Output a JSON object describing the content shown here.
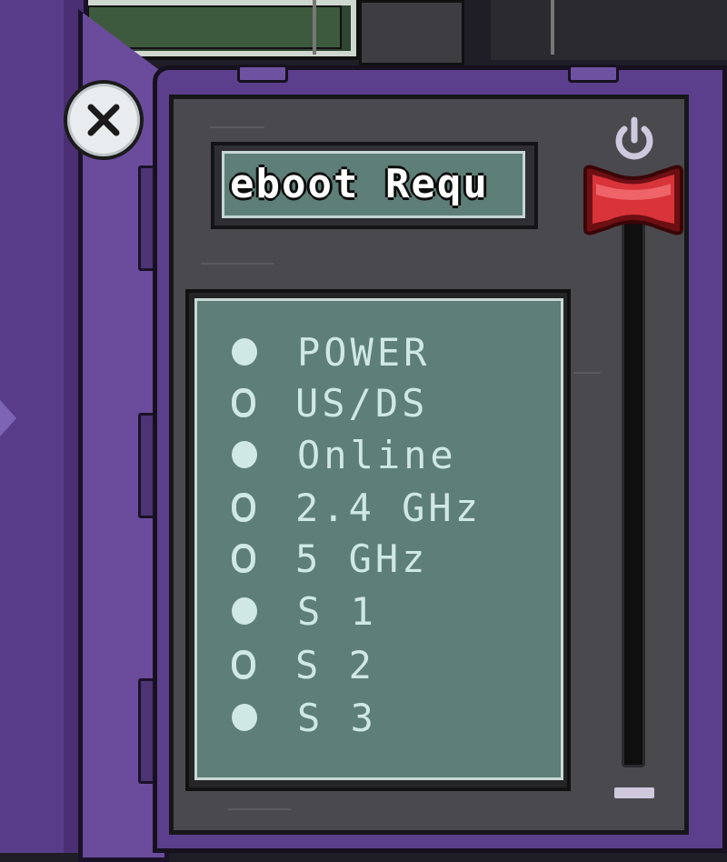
{
  "task": {
    "title_scroll_text": "eboot Requ"
  },
  "status_lights": [
    {
      "label": "POWER",
      "lit": true
    },
    {
      "label": "US/DS",
      "lit": false
    },
    {
      "label": "Online",
      "lit": true
    },
    {
      "label": "2.4 GHz",
      "lit": false
    },
    {
      "label": "5 GHz",
      "lit": false
    },
    {
      "label": "S 1",
      "lit": true
    },
    {
      "label": "S 2",
      "lit": false
    },
    {
      "label": "S 3",
      "lit": true
    }
  ],
  "power_lever": {
    "icon": "power-icon",
    "position": "top",
    "handle_color": "#d8343a"
  },
  "close_button": {
    "icon": "close-icon"
  },
  "colors": {
    "screen": "#5e7e78",
    "screen_text": "#cfe8e4",
    "frame": "#5b3f8c"
  }
}
